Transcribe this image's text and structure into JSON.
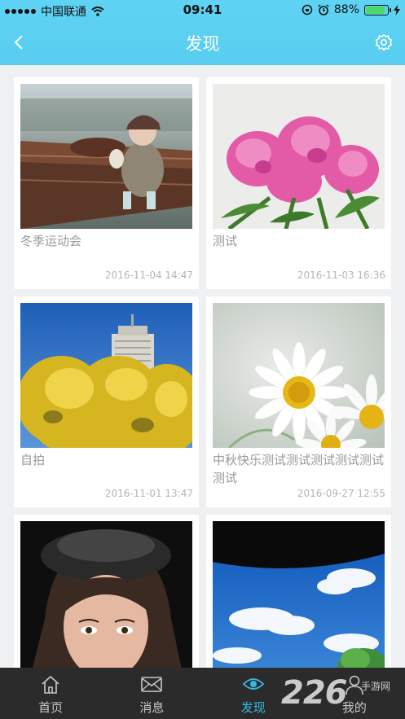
{
  "status": {
    "carrier": "中国联通",
    "time": "09:41",
    "battery_pct_text": "88%",
    "battery_level": 0.88
  },
  "nav": {
    "title": "发现",
    "back_icon": "chevron-left-icon",
    "settings_icon": "gear-icon"
  },
  "cards": [
    {
      "title": "冬季运动会",
      "date": "2016-11-04 14:47"
    },
    {
      "title": "测试",
      "date": "2016-11-03 16:36"
    },
    {
      "title": "自拍",
      "date": "2016-11-01 13:47"
    },
    {
      "title": "中秋快乐测试测试测试测试测试测试",
      "date": "2016-09-27 12:55"
    }
  ],
  "tabs": [
    {
      "label": "首页",
      "icon": "home-icon"
    },
    {
      "label": "消息",
      "icon": "mail-icon"
    },
    {
      "label": "发现",
      "icon": "eye-icon",
      "active": true
    },
    {
      "label": "我的",
      "icon": "person-icon"
    }
  ],
  "watermark": {
    "number": "226",
    "text": "手游网"
  },
  "colors": {
    "header": "#5ed3f3",
    "tabbar": "#2b2b2b",
    "active_tab": "#38b8e6",
    "background": "#eef0f2"
  }
}
